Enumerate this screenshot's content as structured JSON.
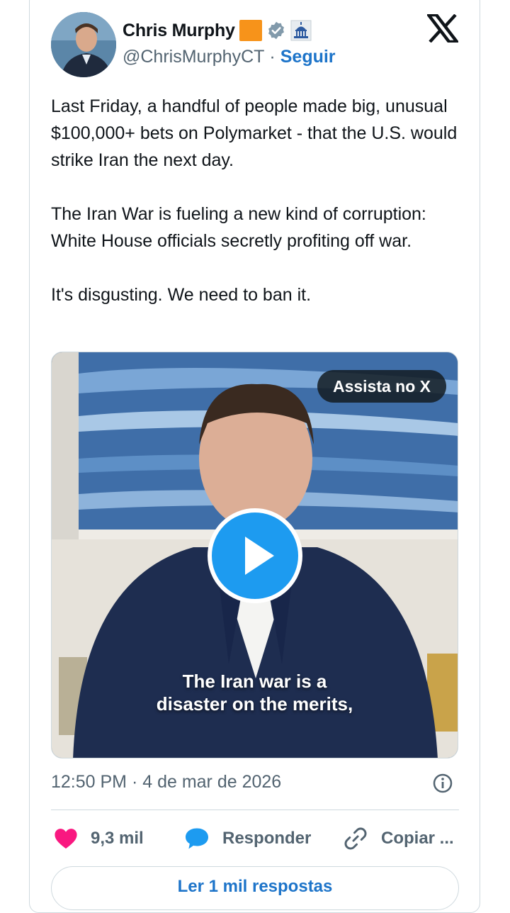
{
  "author": {
    "display_name": "Chris Murphy",
    "handle": "@ChrisMurphyCT",
    "separator": "·",
    "follow_label": "Seguir"
  },
  "icons": {
    "brand_logo": "x-logo-icon",
    "verified": "verified-badge-icon",
    "affiliation": "capitol-icon",
    "like": "heart-icon",
    "reply": "speech-bubble-icon",
    "copy": "link-icon",
    "info": "info-icon",
    "play": "play-icon"
  },
  "tweet": {
    "paragraphs": [
      "Last Friday, a handful of people made big, unusual $100,000+ bets on Polymarket - that the U.S. would strike Iran the next day.",
      "The Iran War is fueling a new kind of corruption: White House officials secretly profiting off war.",
      "It's disgusting. We need to ban it."
    ]
  },
  "media": {
    "watch_label": "Assista no X",
    "caption_line1": "The Iran war is a",
    "caption_line2": "disaster on the merits,"
  },
  "meta": {
    "timestamp": "12:50 PM · 4 de mar de 2026"
  },
  "actions": {
    "likes": "9,3 mil",
    "reply_label": "Responder",
    "copy_label": "Copiar ..."
  },
  "replies": {
    "read_label": "Ler 1 mil respostas"
  },
  "colors": {
    "accent": "#1d9bf0",
    "link": "#1d74c9",
    "heart": "#f91880",
    "orange_badge": "#f7931a",
    "muted_text": "#536471"
  }
}
